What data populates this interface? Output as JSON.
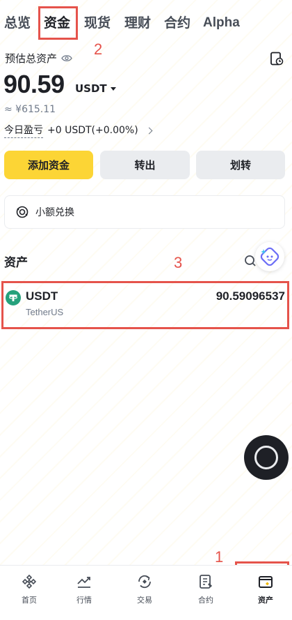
{
  "top_tabs": [
    {
      "label": "总览"
    },
    {
      "label": "资金",
      "active": true
    },
    {
      "label": "现货"
    },
    {
      "label": "理财"
    },
    {
      "label": "合约"
    },
    {
      "label": "Alpha"
    }
  ],
  "summary": {
    "estimated_label": "预估总资产",
    "balance": "90.59",
    "unit": "USDT",
    "cny_value": "≈ ¥615.11",
    "pnl_label": "今日盈亏",
    "pnl_value": "+0 USDT(+0.00%)"
  },
  "actions": {
    "add_funds": "添加资金",
    "transfer_out": "转出",
    "transfer": "划转"
  },
  "small_convert": {
    "label": "小额兑换"
  },
  "assets": {
    "title": "资产",
    "items": [
      {
        "symbol": "USDT",
        "name": "TetherUS",
        "amount": "90.59096537",
        "icon": "tether-icon"
      }
    ]
  },
  "bottom_nav": [
    {
      "label": "首页",
      "icon": "home-icon"
    },
    {
      "label": "行情",
      "icon": "markets-icon"
    },
    {
      "label": "交易",
      "icon": "trade-icon"
    },
    {
      "label": "合约",
      "icon": "futures-icon"
    },
    {
      "label": "资产",
      "icon": "wallet-icon",
      "active": true
    }
  ],
  "annotations": [
    "1",
    "2",
    "3"
  ],
  "colors": {
    "brand_yellow": "#fcd535",
    "tether_green": "#26a17b",
    "annotation_red": "#e5534b",
    "text_primary": "#1e2026",
    "text_secondary": "#707a8a",
    "button_gray": "#eaecef"
  }
}
